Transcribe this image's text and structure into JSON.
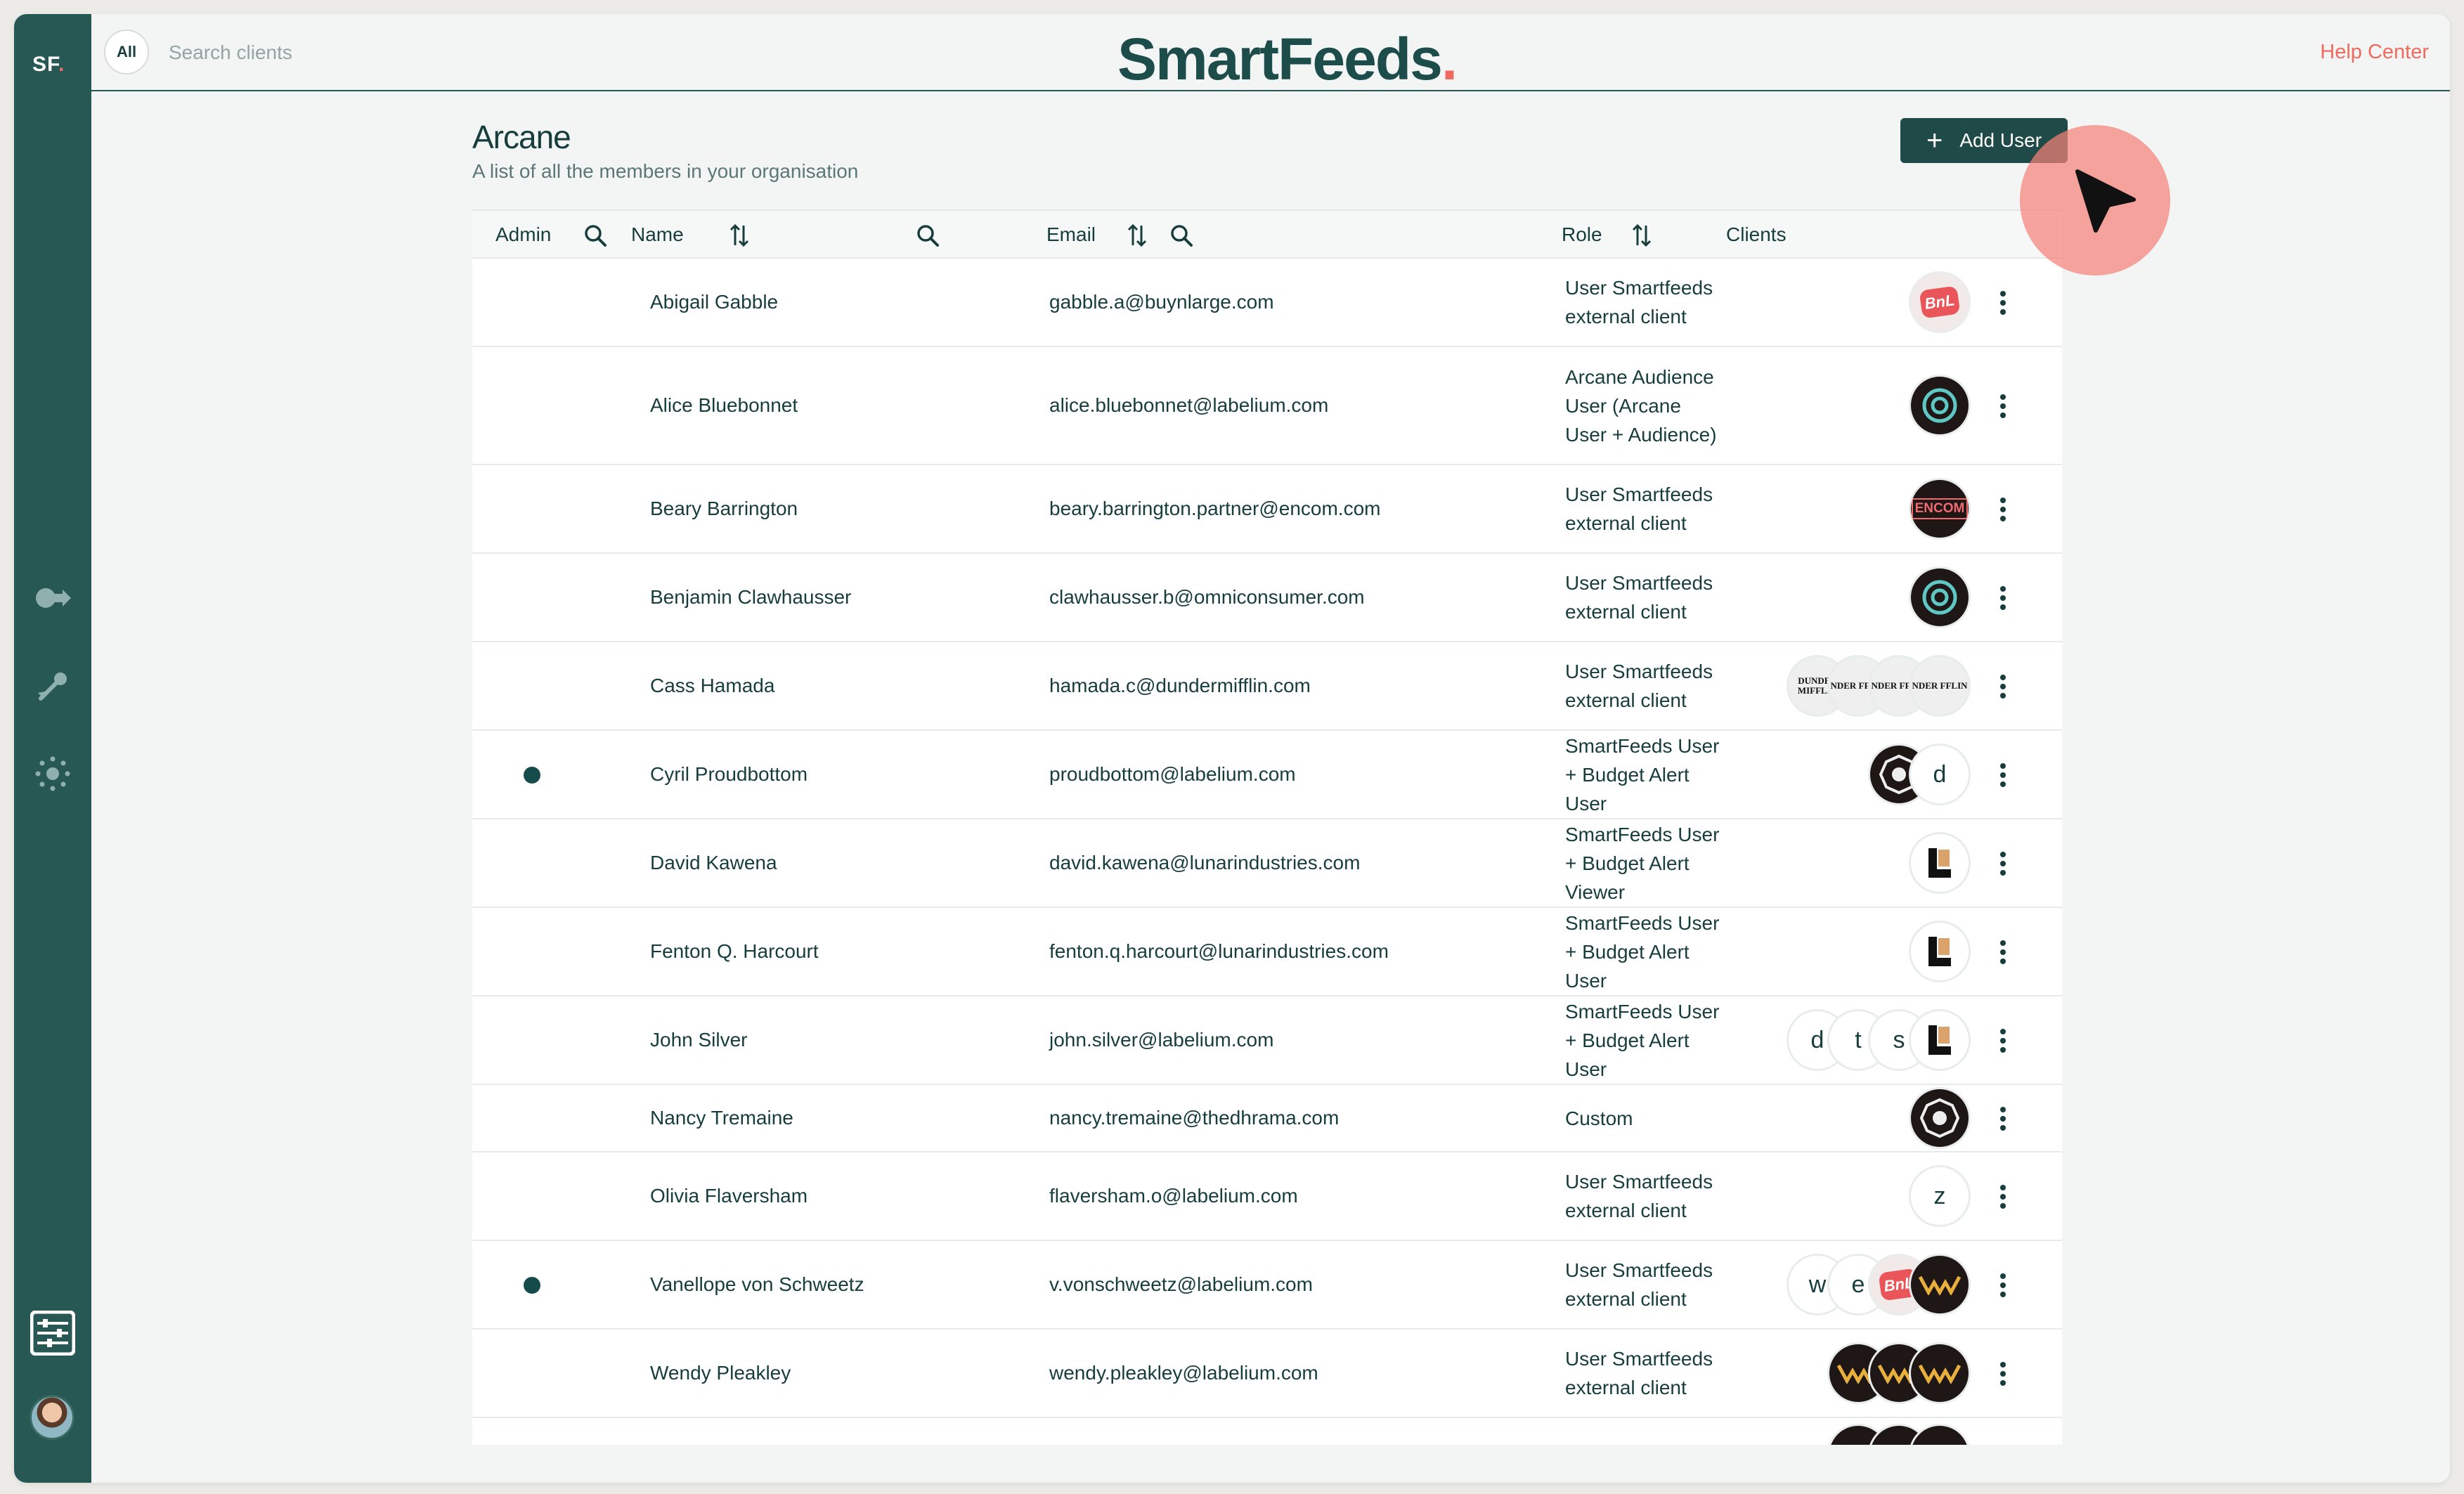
{
  "sidebar": {
    "logo": "SF",
    "logo_dot": "."
  },
  "topbar": {
    "all_label": "All",
    "search_placeholder": "Search clients",
    "brand": "SmartFeeds",
    "brand_dot": ".",
    "help_label": "Help Center"
  },
  "page": {
    "title": "Arcane",
    "subtitle": "A list of all the members in your organisation",
    "add_user_label": "Add User"
  },
  "table": {
    "headers": {
      "admin": "Admin",
      "name": "Name",
      "email": "Email",
      "role": "Role",
      "clients": "Clients"
    },
    "rows": [
      {
        "name": "Abigail Gabble",
        "email": "gabble.a@buynlarge.com",
        "role": "User Smartfeeds external client",
        "admin": false,
        "height": 126
      },
      {
        "name": "Alice Bluebonnet",
        "email": "alice.bluebonnet@labelium.com",
        "role": "Arcane Audience User (Arcane User + Audience)",
        "admin": false,
        "height": 168
      },
      {
        "name": "Beary Barrington",
        "email": "beary.barrington.partner@encom.com",
        "role": "User Smartfeeds external client",
        "admin": false,
        "height": 126
      },
      {
        "name": "Benjamin Clawhausser",
        "email": "clawhausser.b@omniconsumer.com",
        "role": "User Smartfeeds external client",
        "admin": false,
        "height": 126
      },
      {
        "name": "Cass Hamada",
        "email": "hamada.c@dundermifflin.com",
        "role": "User Smartfeeds external client",
        "admin": false,
        "height": 126
      },
      {
        "name": "Cyril Proudbottom",
        "email": "proudbottom@labelium.com",
        "role": "SmartFeeds User + Budget Alert User",
        "admin": true,
        "height": 126
      },
      {
        "name": "David Kawena",
        "email": "david.kawena@lunarindustries.com",
        "role": "SmartFeeds User + Budget Alert Viewer",
        "admin": false,
        "height": 126
      },
      {
        "name": "Fenton Q. Harcourt",
        "email": "fenton.q.harcourt@lunarindustries.com",
        "role": "SmartFeeds User + Budget Alert User",
        "admin": false,
        "height": 126
      },
      {
        "name": "John Silver",
        "email": "john.silver@labelium.com",
        "role": "SmartFeeds User + Budget Alert User",
        "admin": false,
        "height": 126
      },
      {
        "name": "Nancy Tremaine",
        "email": "nancy.tremaine@thedhrama.com",
        "role": "Custom",
        "admin": false,
        "height": 96
      },
      {
        "name": "Olivia Flaversham",
        "email": "flaversham.o@labelium.com",
        "role": "User Smartfeeds external client",
        "admin": false,
        "height": 126
      },
      {
        "name": "Vanellope von Schweetz",
        "email": "v.vonschweetz@labelium.com",
        "role": "User Smartfeeds external client",
        "admin": true,
        "height": 126
      },
      {
        "name": "Wendy Pleakley",
        "email": "wendy.pleakley@labelium.com",
        "role": "User Smartfeeds external client",
        "admin": false,
        "height": 126
      }
    ]
  },
  "client_logos": {
    "bnl": "BnL",
    "encom": "ENCOM",
    "dunder": "DUNDER MIFFLIN",
    "dunder_partial": "NDER FFLIN"
  },
  "client_letters": {
    "cyril": [
      "d"
    ],
    "john": [
      "d",
      "t",
      "s"
    ],
    "olivia": [
      "z"
    ],
    "vanellope": [
      "w",
      "e"
    ]
  },
  "colors": {
    "sidebar": "#275853",
    "accent": "#ef6b5f",
    "primary_button": "#1f4a47",
    "admin_dot": "#154c4b"
  }
}
